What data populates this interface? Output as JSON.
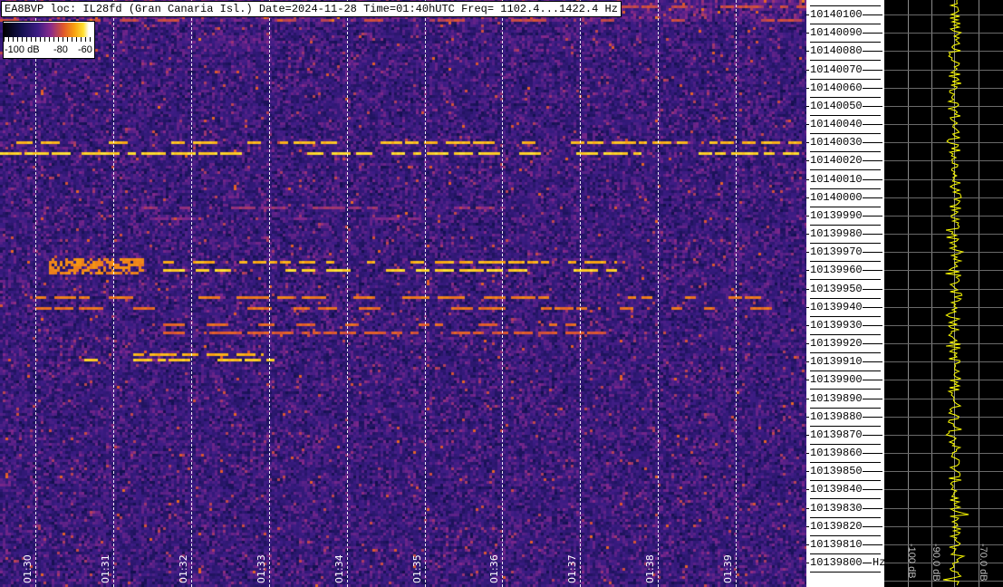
{
  "header": {
    "title": "EA8BVP loc: IL28fd (Gran Canaria Isl.) Date=2024-11-28 Time=01:40hUTC Freq= 1102.4...1422.4 Hz"
  },
  "colorbar": {
    "labels": [
      "-100 dB",
      "-80",
      "-60"
    ],
    "range_db": [
      -100,
      -60
    ]
  },
  "colors": {
    "background": "#3c1c84",
    "signal": "#ffd030",
    "trace": "#ffff00",
    "panel": "#000000"
  },
  "chart_data": {
    "type": "heatmap",
    "title": "",
    "x_ticks": [
      "01:30",
      "01:31",
      "01:32",
      "01:33",
      "01:34",
      "01:35",
      "01:36",
      "01:37",
      "01:38",
      "01:39"
    ],
    "y_ticks": [
      "10140100",
      "10140090",
      "10140080",
      "10140070",
      "10140060",
      "10140050",
      "10140040",
      "10140030",
      "10140020",
      "10140010",
      "10140000",
      "10139990",
      "10139980",
      "10139970",
      "10139960",
      "10139950",
      "10139940",
      "10139930",
      "10139920",
      "10139910",
      "10139900",
      "10139890",
      "10139880",
      "10139870",
      "10139860",
      "10139850",
      "10139840",
      "10139830",
      "10139820",
      "10139810",
      "10139800"
    ],
    "y_unit": "Hz",
    "ylim": [
      10139790,
      10140105
    ],
    "grid": true,
    "strong_signals_hz": [
      10140030,
      10140023,
      10139963,
      10139943,
      10139932,
      10139908
    ],
    "spectrum_panel": {
      "x_ticks": [
        "-100 dB",
        "-90.0 dB",
        "-70.0 dB"
      ]
    }
  }
}
